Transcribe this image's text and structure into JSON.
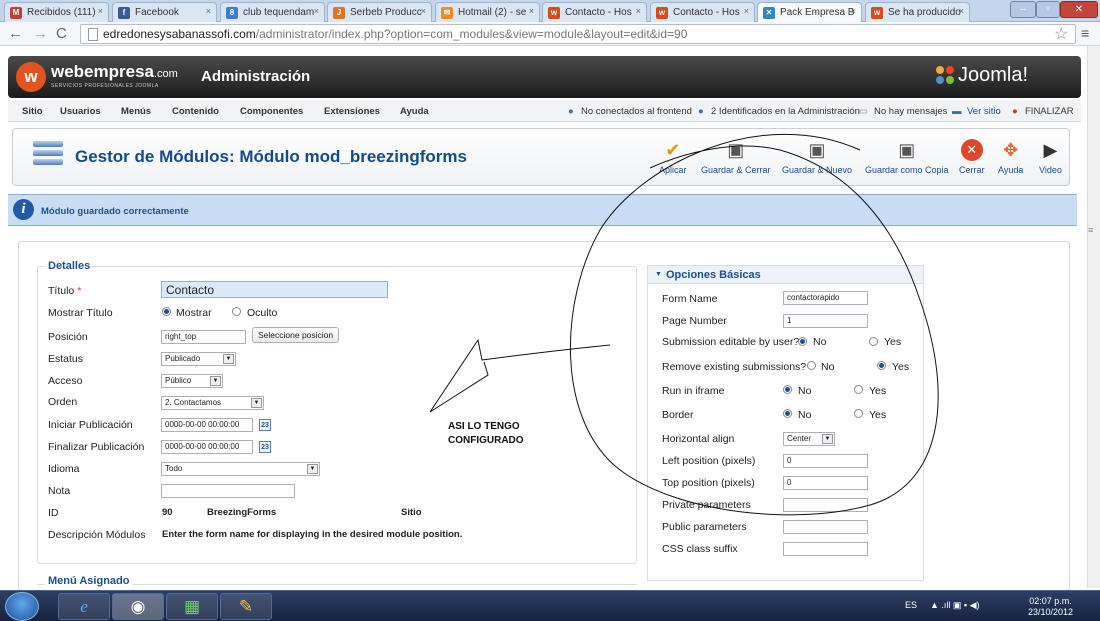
{
  "browser": {
    "tabs": [
      {
        "label": "Recibidos (111)",
        "icon": "gmail-icon",
        "color": "#c5412f",
        "glyph": "M"
      },
      {
        "label": "Facebook",
        "icon": "facebook-icon",
        "color": "#3b5998",
        "glyph": "f"
      },
      {
        "label": "club tequendam",
        "icon": "google-icon",
        "color": "#3e7bd6",
        "glyph": "8"
      },
      {
        "label": "Serbeb Producc",
        "icon": "joomla-icon",
        "color": "#e0751d",
        "glyph": "J"
      },
      {
        "label": "Hotmail (2) - se",
        "icon": "hotmail-icon",
        "color": "#f08a24",
        "glyph": "✉"
      },
      {
        "label": "Contacto - Hos",
        "icon": "webempresa-icon",
        "color": "#d84a1c",
        "glyph": "w"
      },
      {
        "label": "Contacto - Hos",
        "icon": "webempresa-icon",
        "color": "#d84a1c",
        "glyph": "w"
      },
      {
        "label": "Pack Empresa B",
        "icon": "joomla-icon",
        "color": "#2d86c6",
        "glyph": "✕"
      },
      {
        "label": "Se ha producido",
        "icon": "webempresa-icon",
        "color": "#d84a1c",
        "glyph": "w"
      }
    ],
    "url_host": "edredonesysabanassofi.com",
    "url_path": "/administrator/index.php?option=com_modules&view=module&layout=edit&id=90"
  },
  "header": {
    "logo_text": "webempresa",
    "logo_suffix": ".com",
    "logo_sub": "SERVICIOS PROFESIONALES JOOMLA",
    "title": "Administración",
    "joomla": "Joomla!"
  },
  "submenu": {
    "items": [
      "Sitio",
      "Usuarios",
      "Menús",
      "Contenido",
      "Componentes",
      "Extensiones",
      "Ayuda"
    ],
    "status": {
      "frontend": "No conectados al frontend",
      "admins": "2 Identificados en la Administración",
      "messages": "No hay mensajes",
      "view_site": "Ver sitio",
      "logout": "FINALIZAR"
    }
  },
  "toolbar": {
    "page_title": "Gestor de Módulos: Módulo mod_breezingforms",
    "buttons": [
      {
        "label": "Aplicar",
        "icon": "apply-check-icon"
      },
      {
        "label": "Guardar & Cerrar",
        "icon": "save-close-icon"
      },
      {
        "label": "Guardar & Nuevo",
        "icon": "save-new-icon"
      },
      {
        "label": "Guardar como Copia",
        "icon": "save-copy-icon"
      },
      {
        "label": "Cerrar",
        "icon": "close-icon"
      },
      {
        "label": "Ayuda",
        "icon": "help-lifebuoy-icon"
      },
      {
        "label": "Video",
        "icon": "video-icon"
      }
    ]
  },
  "message": "Módulo guardado correctamente",
  "details": {
    "legend": "Detalles",
    "title_label": "Título",
    "title_value": "Contacto",
    "show_title_label": "Mostrar Título",
    "show_option": "Mostrar",
    "hide_option": "Oculto",
    "position_label": "Posición",
    "position_value": "right_top",
    "position_button": "Seleccione posicion",
    "status_label": "Estatus",
    "status_value": "Publicado",
    "access_label": "Acceso",
    "access_value": "Público",
    "order_label": "Orden",
    "order_value": "2. Contactamos",
    "start_label": "Iniciar Publicación",
    "start_value": "0000-00-00 00:00:00",
    "finish_label": "Finalizar Publicación",
    "finish_value": "0000-00-00 00:00:00",
    "language_label": "Idioma",
    "language_value": "Todo",
    "note_label": "Nota",
    "id_label": "ID",
    "id_value": "90",
    "id_type": "BreezingForms",
    "id_scope": "Sitio",
    "desc_label": "Descripción Módulos",
    "desc_value": "Enter the form name for displaying in the desired module position."
  },
  "menu_assign": {
    "legend": "Menú Asignado"
  },
  "basic": {
    "title": "Opciones Básicas",
    "form_name_label": "Form Name",
    "form_name_value": "contactorapido",
    "page_number_label": "Page Number",
    "page_number_value": "1",
    "editable_label": "Submission editable by user?",
    "remove_label": "Remove existing submissions?",
    "iframe_label": "Run in iframe",
    "border_label": "Border",
    "no": "No",
    "yes": "Yes",
    "halign_label": "Horizontal align",
    "halign_value": "Center",
    "left_label": "Left position (pixels)",
    "left_value": "0",
    "top_label": "Top position (pixels)",
    "top_value": "0",
    "private_label": "Private parameters",
    "public_label": "Public parameters",
    "css_label": "CSS class suffix"
  },
  "annotation": {
    "line1": "ASI LO TENGO",
    "line2": "CONFIGURADO"
  },
  "taskbar": {
    "lang": "ES",
    "time": "02:07 p.m.",
    "date": "23/10/2012",
    "apps": [
      "internet-explorer-icon",
      "chrome-icon",
      "excel-icon",
      "paint-icon"
    ]
  }
}
